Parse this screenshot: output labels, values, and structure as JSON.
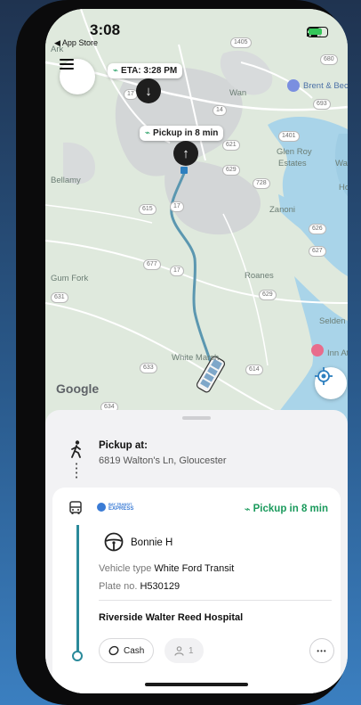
{
  "status_bar": {
    "time": "3:08",
    "back_app": "◀ App Store"
  },
  "map": {
    "eta_pill": "ETA: 3:28 PM",
    "pickup_pill": "Pickup in 8 min",
    "google": "Google",
    "places": {
      "ark": "Ark",
      "wan": "Wan",
      "brent": "Brent & Becky",
      "glen_roy": "Glen Roy",
      "estates": "Estates",
      "ware": "Ware",
      "hock": "Hock",
      "bellamy": "Bellamy",
      "zanoni": "Zanoni",
      "gum_fork": "Gum Fork",
      "roanes": "Roanes",
      "selden": "Selden",
      "inn": "Inn At W",
      "white_marsh": "White Marsh"
    },
    "shields": [
      "1405",
      "680",
      "693",
      "17",
      "14",
      "1401",
      "621",
      "629",
      "728",
      "615",
      "17",
      "626",
      "627",
      "677",
      "17",
      "629",
      "631",
      "633",
      "614",
      "634"
    ],
    "colors": {
      "route": "#5b97b0",
      "town": "#cfd2d3",
      "water": "#a7d3e8"
    }
  },
  "sheet": {
    "pickup_title": "Pickup at:",
    "pickup_address": "6819 Walton's Ln, Gloucester",
    "brand_line1": "BAY TRANSIT",
    "brand_line2": "EXPRESS",
    "pickup_eta": "Pickup in 8 min",
    "driver_name": "Bonnie H",
    "vehicle_label": "Vehicle type",
    "vehicle_value": "White Ford Transit",
    "plate_label": "Plate no.",
    "plate_value": "H530129",
    "destination": "Riverside Walter Reed Hospital",
    "payment_label": "Cash",
    "passenger_count": "1",
    "more_label": "•••",
    "colors": {
      "accent_green": "#1a9a5c",
      "route_teal": "#2a8a9a"
    }
  }
}
